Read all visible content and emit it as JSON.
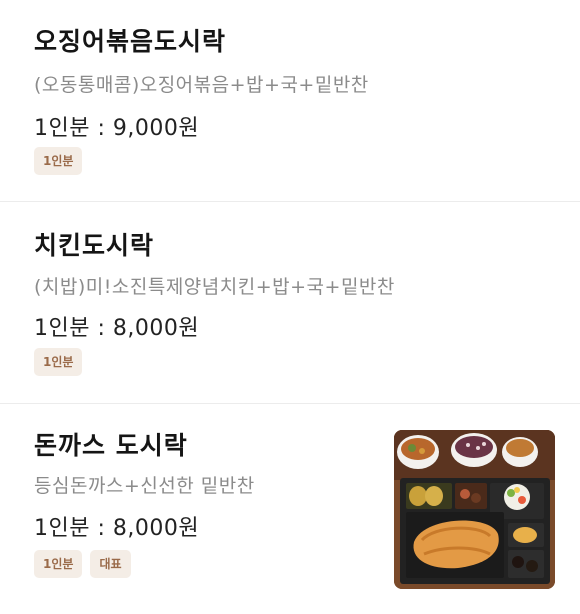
{
  "menu": {
    "items": [
      {
        "name": "오징어볶음도시락",
        "description": "(오동통매콤)오징어볶음+밥+국+밑반찬",
        "price": "1인분 : 9,000원",
        "badges": [
          "1인분"
        ]
      },
      {
        "name": "치킨도시락",
        "description": "(치밥)미!소진특제양념치킨+밥+국+밑반찬",
        "price": "1인분 : 8,000원",
        "badges": [
          "1인분"
        ]
      },
      {
        "name": "돈까스 도시락",
        "description": "등심돈까스+신선한 밑반찬",
        "price": "1인분 : 8,000원",
        "badges": [
          "1인분",
          "대표"
        ]
      }
    ]
  },
  "colors": {
    "badge_bg": "#f4ede6",
    "badge_text": "#9a6a49",
    "divider": "#ececec",
    "description": "#8b8b8b"
  }
}
